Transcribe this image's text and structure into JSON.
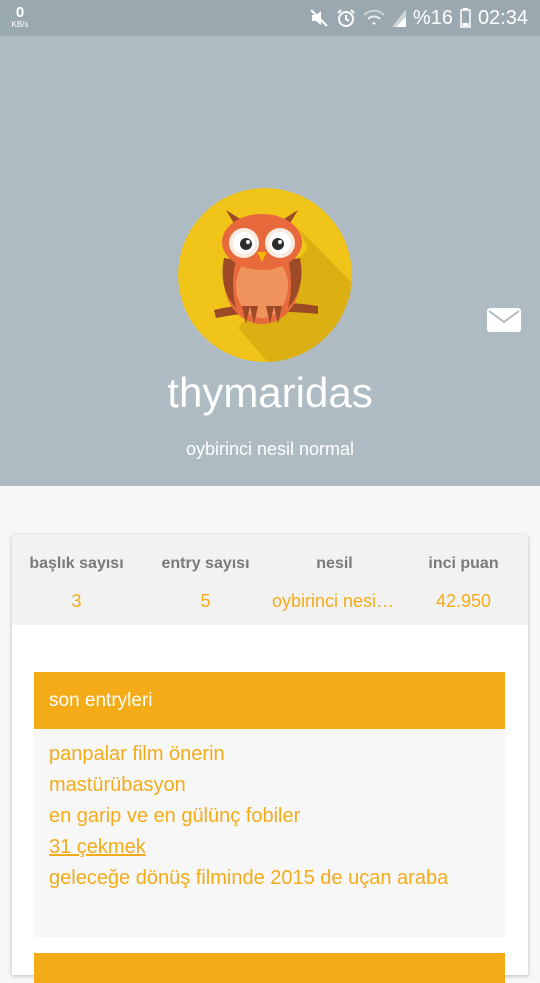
{
  "status_bar": {
    "speed_value": "0",
    "speed_unit": "KB/s",
    "battery_percent": "%16",
    "time": "02:34",
    "icons": [
      "mute-icon",
      "alarm-icon",
      "wifi-icon",
      "signal-icon",
      "battery-icon"
    ]
  },
  "profile": {
    "username": "thymaridas",
    "generation": "oybirinci nesil normal",
    "avatar_icon": "owl-avatar",
    "message_icon": "mail-icon"
  },
  "stats": [
    {
      "label": "başlık sayısı",
      "value": "3"
    },
    {
      "label": "entry sayısı",
      "value": "5"
    },
    {
      "label": "nesil",
      "value": "oybirinci nesil normal"
    },
    {
      "label": "inci puan",
      "value": "42.950"
    }
  ],
  "recent_entries": {
    "title": "son entryleri",
    "items": [
      "panpalar film önerin",
      "mastürübasyon",
      "en garip ve en gülünç fobiler",
      "31 çekmek",
      "geleceğe dönüş filminde 2015 de uçan araba"
    ]
  },
  "colors": {
    "accent": "#f4ab18",
    "header_bg": "#aebbc3",
    "status_bar_bg": "#9aa8b0"
  }
}
